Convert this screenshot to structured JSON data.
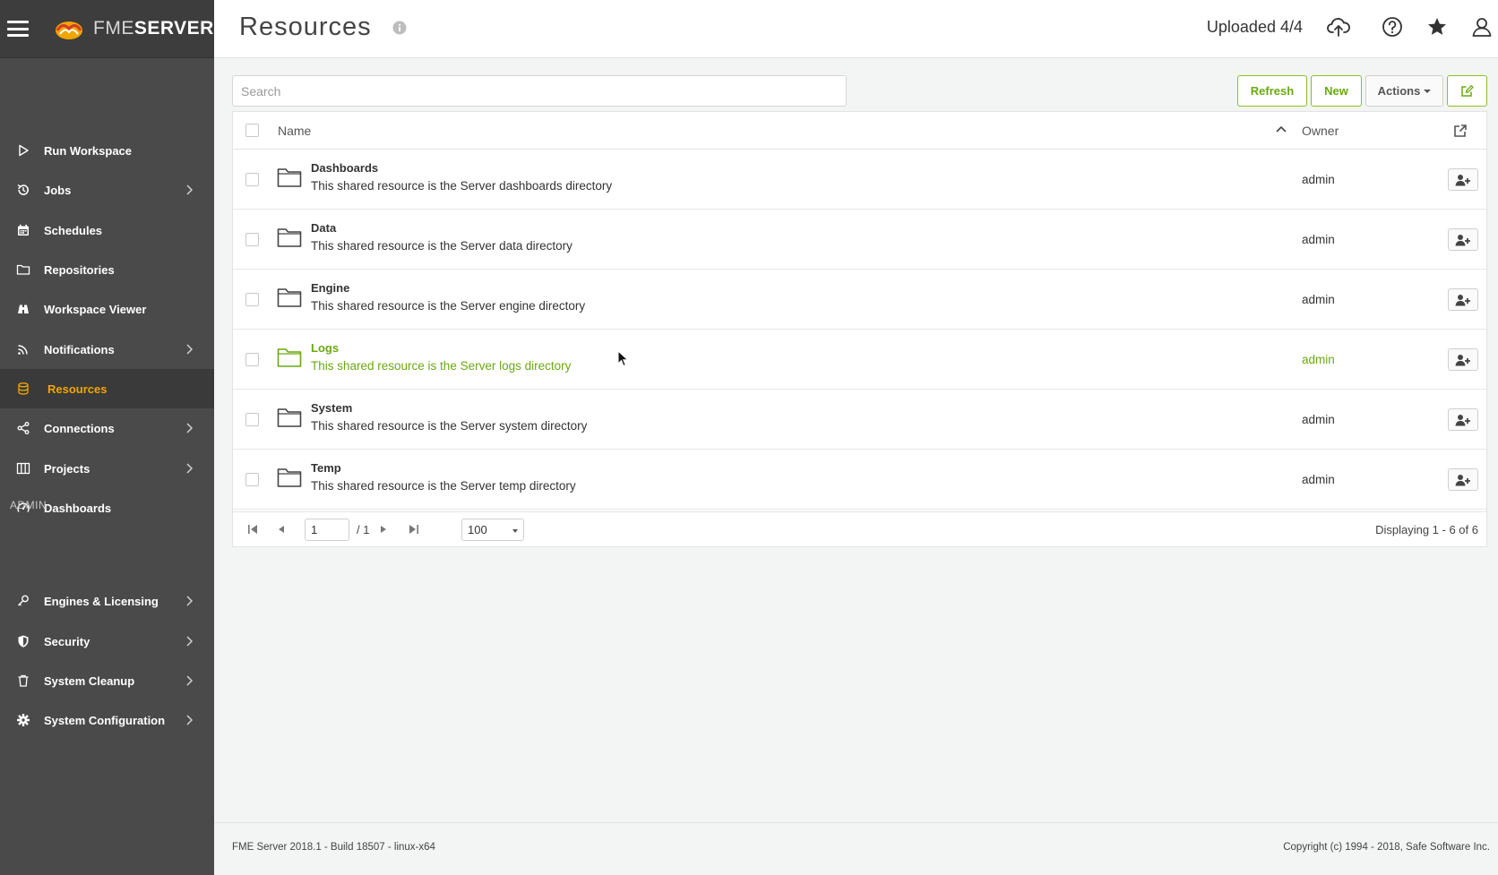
{
  "brand": {
    "prefix": "FME",
    "suffix": "SERVER"
  },
  "colors": {
    "accent": "#6aa912",
    "active_nav": "#f0a500",
    "sidebar_bg": "#4a4a4a"
  },
  "sidebar": {
    "items": [
      {
        "label": "Run Workspace",
        "icon": "play-icon",
        "has_submenu": false
      },
      {
        "label": "Jobs",
        "icon": "history-icon",
        "has_submenu": true
      },
      {
        "label": "Schedules",
        "icon": "calendar-icon",
        "has_submenu": false
      },
      {
        "label": "Repositories",
        "icon": "folder-icon",
        "has_submenu": false
      },
      {
        "label": "Workspace Viewer",
        "icon": "binoculars-icon",
        "has_submenu": false
      },
      {
        "label": "Notifications",
        "icon": "rss-icon",
        "has_submenu": true
      },
      {
        "label": "Resources",
        "icon": "database-icon",
        "has_submenu": false,
        "active": true
      },
      {
        "label": "Connections",
        "icon": "share-icon",
        "has_submenu": true
      },
      {
        "label": "Projects",
        "icon": "columns-icon",
        "has_submenu": true
      },
      {
        "label": "Dashboards",
        "icon": "gauge-icon",
        "has_submenu": false
      }
    ],
    "admin_header": "ADMIN",
    "admin_items": [
      {
        "label": "Engines & Licensing",
        "icon": "key-icon",
        "has_submenu": true
      },
      {
        "label": "Security",
        "icon": "shield-icon",
        "has_submenu": true
      },
      {
        "label": "System Cleanup",
        "icon": "trash-icon",
        "has_submenu": true
      },
      {
        "label": "System Configuration",
        "icon": "gear-icon",
        "has_submenu": true
      }
    ]
  },
  "header": {
    "title": "Resources",
    "upload_status": "Uploaded 4/4"
  },
  "toolbar": {
    "search_placeholder": "Search",
    "refresh_label": "Refresh",
    "new_label": "New",
    "actions_label": "Actions"
  },
  "table": {
    "columns": {
      "name": "Name",
      "owner": "Owner"
    },
    "rows": [
      {
        "name": "Dashboards",
        "description": "This shared resource is the Server dashboards directory",
        "owner": "admin"
      },
      {
        "name": "Data",
        "description": "This shared resource is the Server data directory",
        "owner": "admin"
      },
      {
        "name": "Engine",
        "description": "This shared resource is the Server engine directory",
        "owner": "admin"
      },
      {
        "name": "Logs",
        "description": "This shared resource is the Server logs directory",
        "owner": "admin",
        "highlighted": true
      },
      {
        "name": "System",
        "description": "This shared resource is the Server system directory",
        "owner": "admin"
      },
      {
        "name": "Temp",
        "description": "This shared resource is the Server temp directory",
        "owner": "admin"
      }
    ]
  },
  "pagination": {
    "current_page": "1",
    "total_pages": "/ 1",
    "page_size": "100",
    "displaying": "Displaying 1 - 6 of 6"
  },
  "footer": {
    "version": "FME Server 2018.1 - Build 18507 - linux-x64",
    "copyright": "Copyright (c) 1994 - 2018, Safe Software Inc."
  }
}
